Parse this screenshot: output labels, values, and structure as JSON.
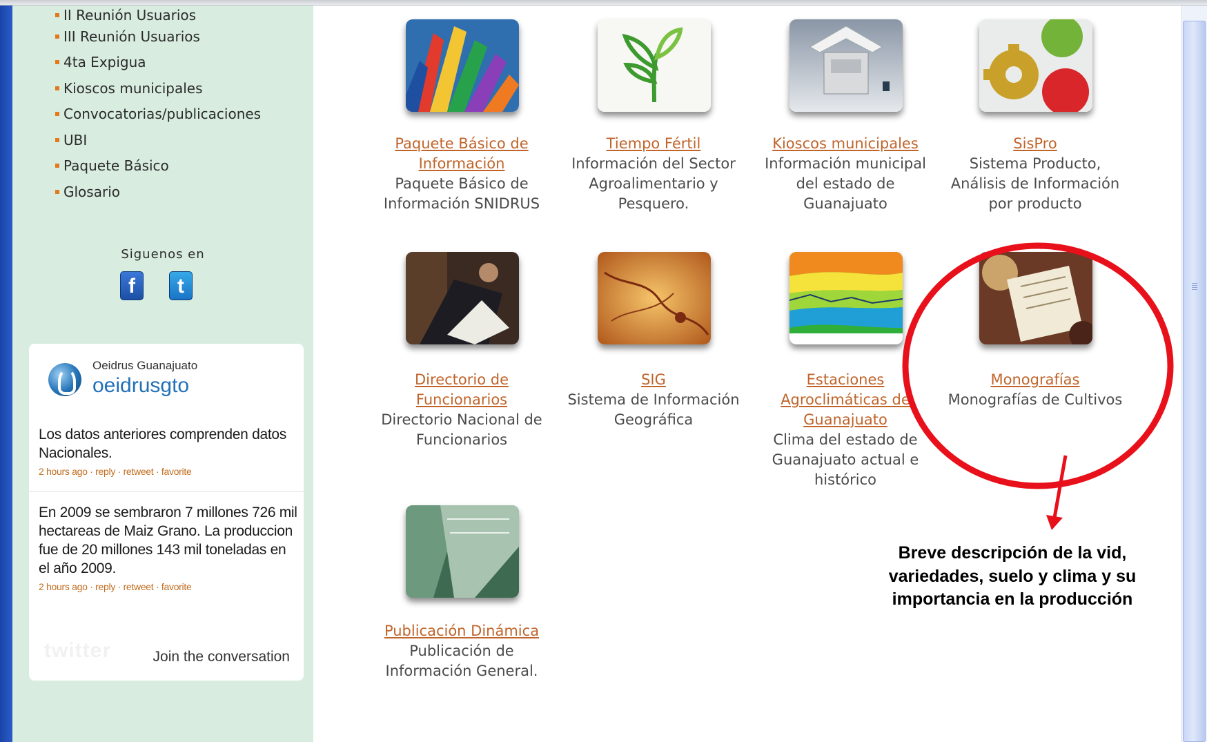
{
  "sidebar": {
    "nav_items": [
      {
        "label": "II Reunión Usuarios"
      },
      {
        "label": "III Reunión Usuarios"
      },
      {
        "label": "4ta Expigua"
      },
      {
        "label": "Kioscos municipales"
      },
      {
        "label": "Convocatorias/publicaciones"
      },
      {
        "label": "UBI"
      },
      {
        "label": "Paquete Básico"
      },
      {
        "label": "Glosario"
      }
    ],
    "follow_label": "Siguenos en",
    "social": {
      "facebook_glyph": "f",
      "twitter_glyph": "t",
      "facebook_icon": "facebook-icon",
      "twitter_icon": "twitter-icon"
    }
  },
  "twitter_widget": {
    "display_name": "Oeidrus Guanajuato",
    "handle": "oeidrusgto",
    "tweets": [
      {
        "text": "Los datos anteriores comprenden datos Nacionales.",
        "meta": "2 hours ago · reply · retweet · favorite"
      },
      {
        "text": "En 2009 se sembraron 7 millones 726 mil hectareas de Maiz Grano. La produccion fue de 20 millones 143 mil toneladas en el año 2009.",
        "meta": "2 hours ago · reply · retweet · favorite"
      }
    ],
    "logo_text": "twitter",
    "join_label": "Join the conversation"
  },
  "tiles": [
    {
      "title": "Paquete Básico de Información",
      "desc": "Paquete Básico de Información SNIDRUS",
      "icon": "crayons-icon"
    },
    {
      "title": "Tiempo Fértil",
      "desc": "Información del Sector Agroalimentario y Pesquero.",
      "icon": "sprout-icon"
    },
    {
      "title": "Kioscos municipales",
      "desc": "Información municipal del estado de Guanajuato",
      "icon": "kiosk-icon"
    },
    {
      "title": "SisPro",
      "desc": "Sistema Producto, Análisis de Información por producto",
      "icon": "gears-icon"
    },
    {
      "title": "Directorio de Funcionarios",
      "desc": "Directorio Nacional de Funcionarios",
      "icon": "businessman-icon"
    },
    {
      "title": "SIG",
      "desc": "Sistema de Información Geográfica",
      "icon": "map-icon"
    },
    {
      "title": "Estaciones Agroclimáticas de Guanajuato",
      "desc": "Clima del estado de Guanajuato actual e histórico",
      "icon": "climate-chart-icon"
    },
    {
      "title": "Monografías",
      "desc": "Monografías de Cultivos",
      "icon": "menu-book-icon"
    },
    {
      "title": "Publicación Dinámica",
      "desc": "Publicación de Información General.",
      "icon": "publication-icon"
    }
  ],
  "annotation": {
    "text": "Breve descripción de la vid, variedades, suelo y clima y su importancia en la producción",
    "color": "#e8101a"
  },
  "colors": {
    "sidebar_bg": "#d8ecdf",
    "link": "#c0642a",
    "rail": "#1a44a8"
  }
}
